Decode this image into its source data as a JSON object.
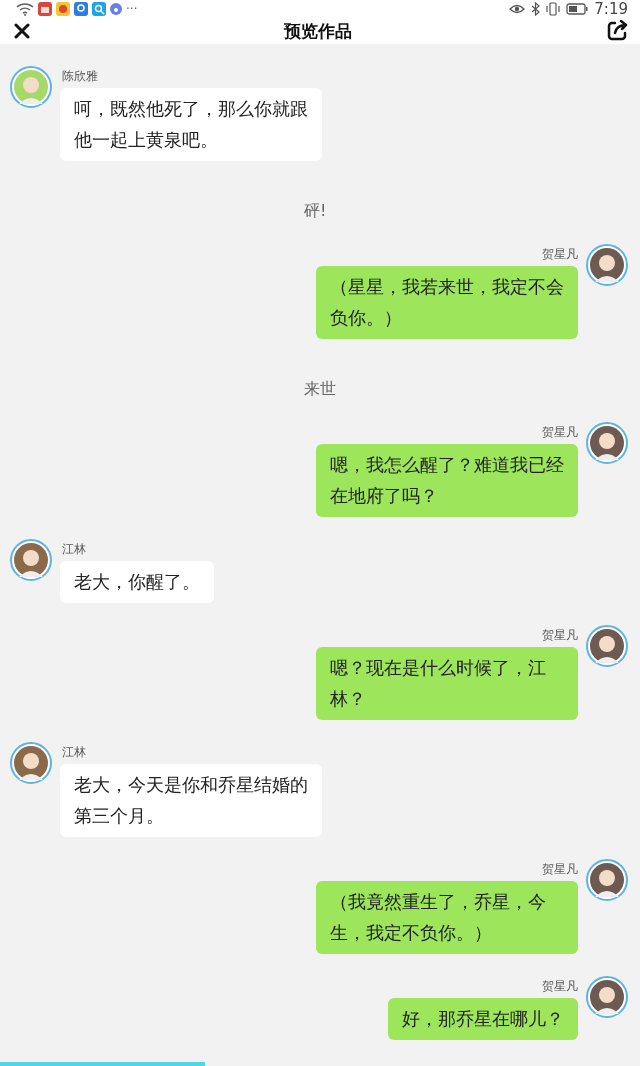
{
  "status_bar": {
    "time": "7:19",
    "more": "···"
  },
  "header": {
    "title": "预览作品"
  },
  "messages": [
    {
      "kind": "left",
      "name": "陈欣雅",
      "text": "呵，既然他死了，那么你就跟他一起上黄泉吧。",
      "color": "#a6d86a"
    },
    {
      "kind": "narration",
      "text": "砰!"
    },
    {
      "kind": "right",
      "name": "贺星凡",
      "text": "（星星，我若来世，我定不会负你。）",
      "color": "#6e5a50"
    },
    {
      "kind": "narration",
      "text": "来世"
    },
    {
      "kind": "right",
      "name": "贺星凡",
      "text": "嗯，我怎么醒了？难道我已经在地府了吗？",
      "color": "#6e5a50"
    },
    {
      "kind": "left",
      "name": "江林",
      "text": "老大，你醒了。",
      "color": "#8a6a4a"
    },
    {
      "kind": "right",
      "name": "贺星凡",
      "text": "嗯？现在是什么时候了，江林？",
      "color": "#6e5a50"
    },
    {
      "kind": "left",
      "name": "江林",
      "text": "老大，今天是你和乔星结婚的第三个月。",
      "color": "#8a6a4a"
    },
    {
      "kind": "right",
      "name": "贺星凡",
      "text": "（我竟然重生了，乔星，今生，我定不负你。）",
      "color": "#6e5a50"
    },
    {
      "kind": "right",
      "name": "贺星凡",
      "text": "好，那乔星在哪儿？",
      "color": "#6e5a50"
    }
  ],
  "progress": {
    "level": 0.32
  }
}
